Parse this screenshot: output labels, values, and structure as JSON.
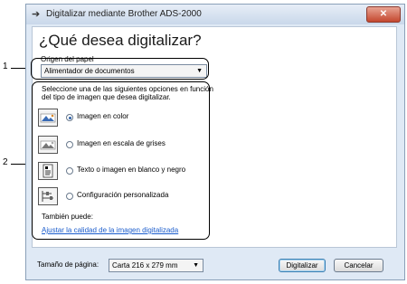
{
  "window": {
    "title": "Digitalizar mediante Brother ADS-2000",
    "close_glyph": "✕"
  },
  "heading": "¿Qué desea digitalizar?",
  "paper_source": {
    "label": "Origen del papel",
    "value": "Alimentador de documentos"
  },
  "instructions": "Seleccione una de las siguientes opciones en función del tipo de imagen que desea digitalizar.",
  "options": [
    {
      "label": "Imagen en color",
      "selected": true,
      "icon": "color-image-icon"
    },
    {
      "label": "Imagen en escala de grises",
      "selected": false,
      "icon": "grayscale-image-icon"
    },
    {
      "label": "Texto o imagen en blanco y negro",
      "selected": false,
      "icon": "bw-text-icon"
    },
    {
      "label": "Configuración personalizada",
      "selected": false,
      "icon": "custom-settings-icon"
    }
  ],
  "also": {
    "label": "También puede:",
    "link": "Ajustar la calidad de la imagen digitalizada"
  },
  "page_size": {
    "label": "Tamaño de página:",
    "value": "Carta  216 x 279 mm"
  },
  "buttons": {
    "scan": "Digitalizar",
    "cancel": "Cancelar"
  },
  "callouts": {
    "one": "1",
    "two": "2"
  }
}
